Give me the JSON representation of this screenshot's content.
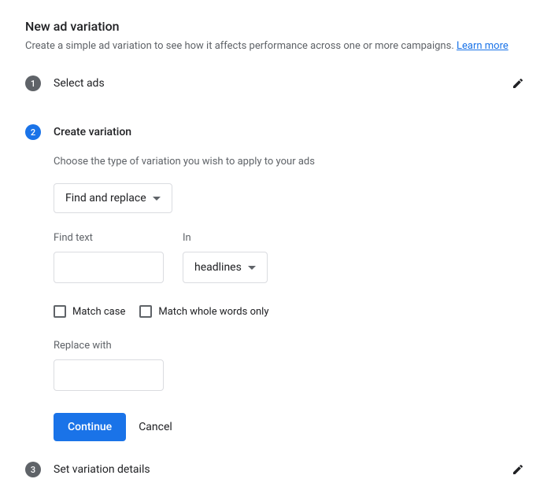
{
  "header": {
    "title": "New ad variation",
    "subtitle": "Create a simple ad variation to see how it affects performance across one or more campaigns. ",
    "learn_more": "Learn more"
  },
  "steps": {
    "s1": {
      "num": "1",
      "title": "Select ads"
    },
    "s2": {
      "num": "2",
      "title": "Create variation",
      "description": "Choose the type of variation you wish to apply to your ads",
      "variation_type": "Find and replace",
      "find_label": "Find text",
      "in_label": "In",
      "in_value": "headlines",
      "match_case": "Match case",
      "match_whole": "Match whole words only",
      "replace_label": "Replace with",
      "continue": "Continue",
      "cancel": "Cancel"
    },
    "s3": {
      "num": "3",
      "title": "Set variation details"
    }
  }
}
